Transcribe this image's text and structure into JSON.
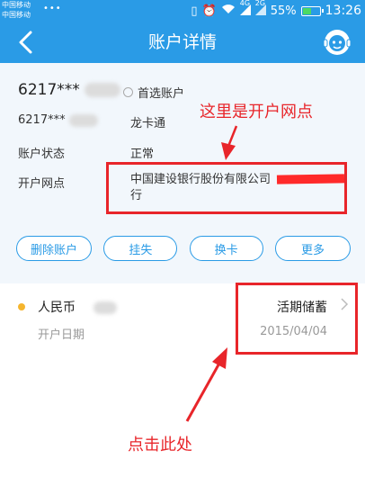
{
  "status_bar": {
    "carrier1": "中国移动",
    "carrier2": "中国移动",
    "dots": "•••",
    "signal_label": "4G",
    "signal_label2": "2G",
    "battery": "55%",
    "battery_level": 0.55,
    "time": "13:26"
  },
  "nav": {
    "title": "账户详情",
    "back_icon": "chevron-left-icon",
    "service_icon": "customer-service-icon"
  },
  "card": {
    "account_number": "6217***",
    "preferred_label": "首选账户",
    "rows": [
      {
        "label": "6217***",
        "value": "龙卡通"
      },
      {
        "label": "账户状态",
        "value": "正常"
      },
      {
        "label": "开户网点",
        "value": "中国建设银行股份有限公司　　　　　行"
      }
    ],
    "buttons": [
      "删除账户",
      "挂失",
      "换卡",
      "更多"
    ]
  },
  "sub_account": {
    "currency": "人民币",
    "type": "活期储蓄",
    "open_label": "开户日期",
    "open_date": "2015/04/04"
  },
  "annotations": {
    "top": "这里是开户网点",
    "bottom": "点击此处"
  },
  "colors": {
    "primary": "#2a9be6",
    "annotation": "#e8252a",
    "bullet": "#f5b52e"
  }
}
